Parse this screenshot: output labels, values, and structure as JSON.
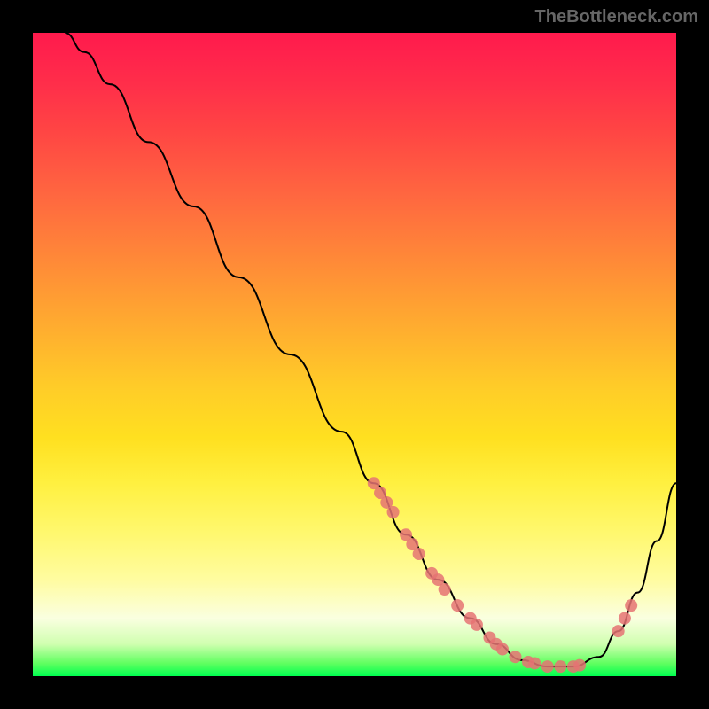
{
  "watermark": "TheBottleneck.com",
  "chart_data": {
    "type": "line",
    "title": "",
    "xlabel": "",
    "ylabel": "",
    "xlim": [
      0,
      100
    ],
    "ylim": [
      0,
      100
    ],
    "curve": [
      {
        "x": 5,
        "y": 100
      },
      {
        "x": 8,
        "y": 97
      },
      {
        "x": 12,
        "y": 92
      },
      {
        "x": 18,
        "y": 83
      },
      {
        "x": 25,
        "y": 73
      },
      {
        "x": 32,
        "y": 62
      },
      {
        "x": 40,
        "y": 50
      },
      {
        "x": 48,
        "y": 38
      },
      {
        "x": 53,
        "y": 30
      },
      {
        "x": 58,
        "y": 22
      },
      {
        "x": 63,
        "y": 15
      },
      {
        "x": 68,
        "y": 9
      },
      {
        "x": 72,
        "y": 5
      },
      {
        "x": 76,
        "y": 2.5
      },
      {
        "x": 80,
        "y": 1.5
      },
      {
        "x": 84,
        "y": 1.5
      },
      {
        "x": 88,
        "y": 3
      },
      {
        "x": 91,
        "y": 7
      },
      {
        "x": 94,
        "y": 13
      },
      {
        "x": 97,
        "y": 21
      },
      {
        "x": 100,
        "y": 30
      }
    ],
    "scatter": [
      {
        "x": 53,
        "y": 30
      },
      {
        "x": 54,
        "y": 28.5
      },
      {
        "x": 55,
        "y": 27
      },
      {
        "x": 56,
        "y": 25.5
      },
      {
        "x": 58,
        "y": 22
      },
      {
        "x": 59,
        "y": 20.5
      },
      {
        "x": 60,
        "y": 19
      },
      {
        "x": 62,
        "y": 16
      },
      {
        "x": 63,
        "y": 15
      },
      {
        "x": 64,
        "y": 13.5
      },
      {
        "x": 66,
        "y": 11
      },
      {
        "x": 68,
        "y": 9
      },
      {
        "x": 69,
        "y": 8
      },
      {
        "x": 71,
        "y": 6
      },
      {
        "x": 72,
        "y": 5
      },
      {
        "x": 73,
        "y": 4.2
      },
      {
        "x": 75,
        "y": 3
      },
      {
        "x": 77,
        "y": 2.2
      },
      {
        "x": 78,
        "y": 2
      },
      {
        "x": 80,
        "y": 1.5
      },
      {
        "x": 82,
        "y": 1.5
      },
      {
        "x": 84,
        "y": 1.5
      },
      {
        "x": 85,
        "y": 1.7
      },
      {
        "x": 91,
        "y": 7
      },
      {
        "x": 92,
        "y": 9
      },
      {
        "x": 93,
        "y": 11
      }
    ]
  }
}
